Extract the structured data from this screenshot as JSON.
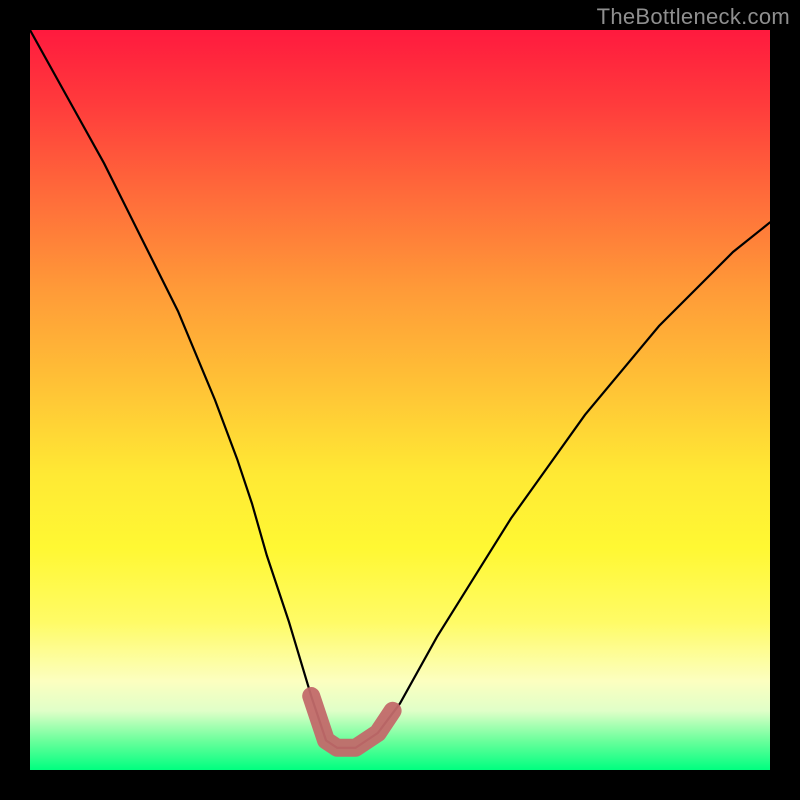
{
  "watermark": "TheBottleneck.com",
  "chart_data": {
    "type": "line",
    "title": "",
    "xlabel": "",
    "ylabel": "",
    "xlim": [
      0,
      100
    ],
    "ylim": [
      0,
      100
    ],
    "grid": false,
    "legend": false,
    "series": [
      {
        "name": "bottleneck-curve",
        "color": "#000000",
        "x": [
          0,
          5,
          10,
          15,
          20,
          25,
          28,
          30,
          32,
          35,
          38,
          40,
          41.5,
          44,
          47,
          50,
          55,
          60,
          65,
          70,
          75,
          80,
          85,
          90,
          95,
          100
        ],
        "y": [
          100,
          91,
          82,
          72,
          62,
          50,
          42,
          36,
          29,
          20,
          10,
          4,
          3,
          3,
          5,
          9,
          18,
          26,
          34,
          41,
          48,
          54,
          60,
          65,
          70,
          74
        ]
      },
      {
        "name": "highlight-band",
        "color": "#c26a6a",
        "x": [
          38,
          40,
          41.5,
          44,
          47,
          49
        ],
        "y": [
          10,
          4,
          3,
          3,
          5,
          8
        ]
      }
    ],
    "gradient_stops": [
      {
        "pos": 0,
        "color": "#ff1a3e"
      },
      {
        "pos": 10,
        "color": "#ff3b3c"
      },
      {
        "pos": 22,
        "color": "#ff6a3a"
      },
      {
        "pos": 35,
        "color": "#ff9a38"
      },
      {
        "pos": 48,
        "color": "#ffc236"
      },
      {
        "pos": 60,
        "color": "#ffe934"
      },
      {
        "pos": 70,
        "color": "#fff833"
      },
      {
        "pos": 80,
        "color": "#fffb66"
      },
      {
        "pos": 88,
        "color": "#fcffc0"
      },
      {
        "pos": 92,
        "color": "#e0ffc8"
      },
      {
        "pos": 96,
        "color": "#6cff9c"
      },
      {
        "pos": 100,
        "color": "#00ff80"
      }
    ]
  }
}
